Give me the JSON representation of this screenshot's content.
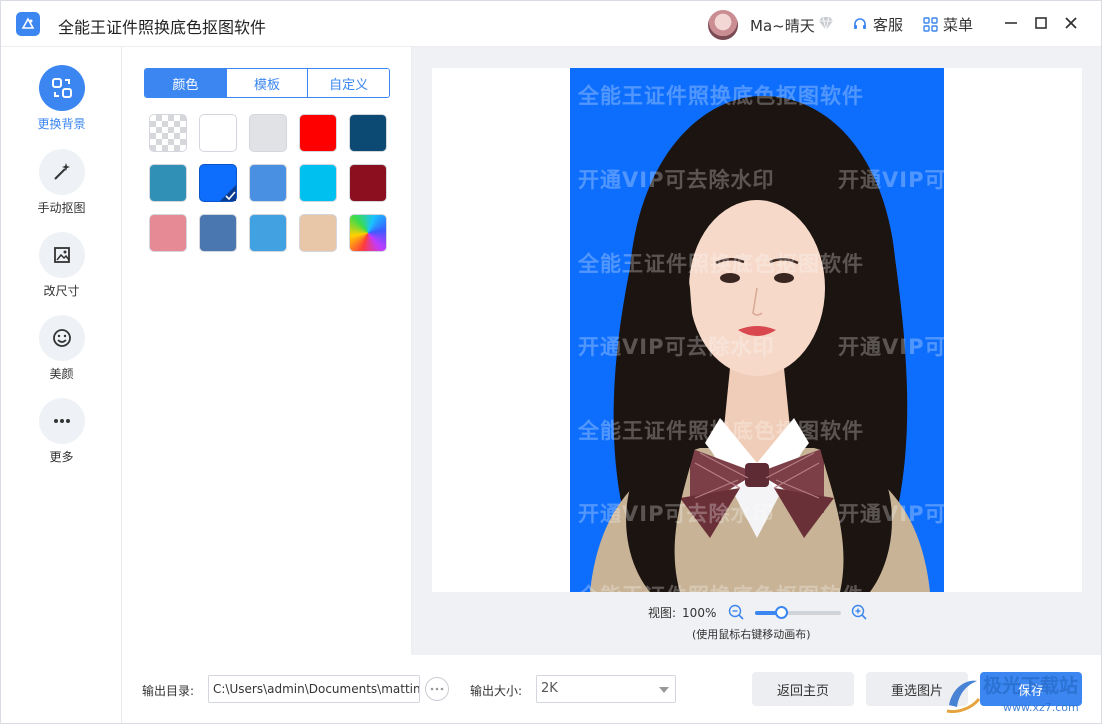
{
  "app": {
    "title": "全能王证件照换底色抠图软件",
    "username": "Ma~晴天",
    "service_label": "客服",
    "menu_label": "菜单"
  },
  "sidebar": {
    "items": [
      {
        "label": "更换背景",
        "icon": "swap-background-icon",
        "active": true
      },
      {
        "label": "手动抠图",
        "icon": "magic-wand-icon",
        "active": false
      },
      {
        "label": "改尺寸",
        "icon": "crop-image-icon",
        "active": false
      },
      {
        "label": "美颜",
        "icon": "smile-face-icon",
        "active": false
      },
      {
        "label": "更多",
        "icon": "more-dots-icon",
        "active": false
      }
    ]
  },
  "panel": {
    "tabs": [
      {
        "label": "颜色",
        "active": true
      },
      {
        "label": "模板",
        "active": false
      },
      {
        "label": "自定义",
        "active": false
      }
    ],
    "swatches": [
      "transparent",
      "#ffffff",
      "#e1e2e6",
      "#ff0000",
      "#0c4a73",
      "#3090b6",
      "#0d6efd",
      "#4a90e2",
      "#00c0ef",
      "#8b0f1f",
      "#e68a96",
      "#4a77b0",
      "#42a1e1",
      "#e8c6a8",
      "gradient"
    ],
    "selected_swatch": "#0d6efd"
  },
  "canvas": {
    "background_color": "#0d6efd",
    "watermark_line_1": "全能王证件照换底色抠图软件",
    "watermark_line_2": "开通VIP可去除水印",
    "zoom_label": "视图:",
    "zoom_value": "100%",
    "zoom_level": 0.3,
    "zoom_hint": "(使用鼠标右键移动画布)"
  },
  "bottom": {
    "output_dir_label": "输出目录:",
    "output_dir_value": "C:\\Users\\admin\\Documents\\matting",
    "output_size_label": "输出大小:",
    "output_size_value": "2K",
    "back_home_label": "返回主页",
    "reselect_label": "重选图片",
    "save_label": "保存"
  },
  "site_watermark": {
    "name": "极光下载站",
    "url": "www.xz7.com"
  },
  "colors": {
    "accent": "#3b86f0",
    "photo_background": "#0d6efd"
  }
}
